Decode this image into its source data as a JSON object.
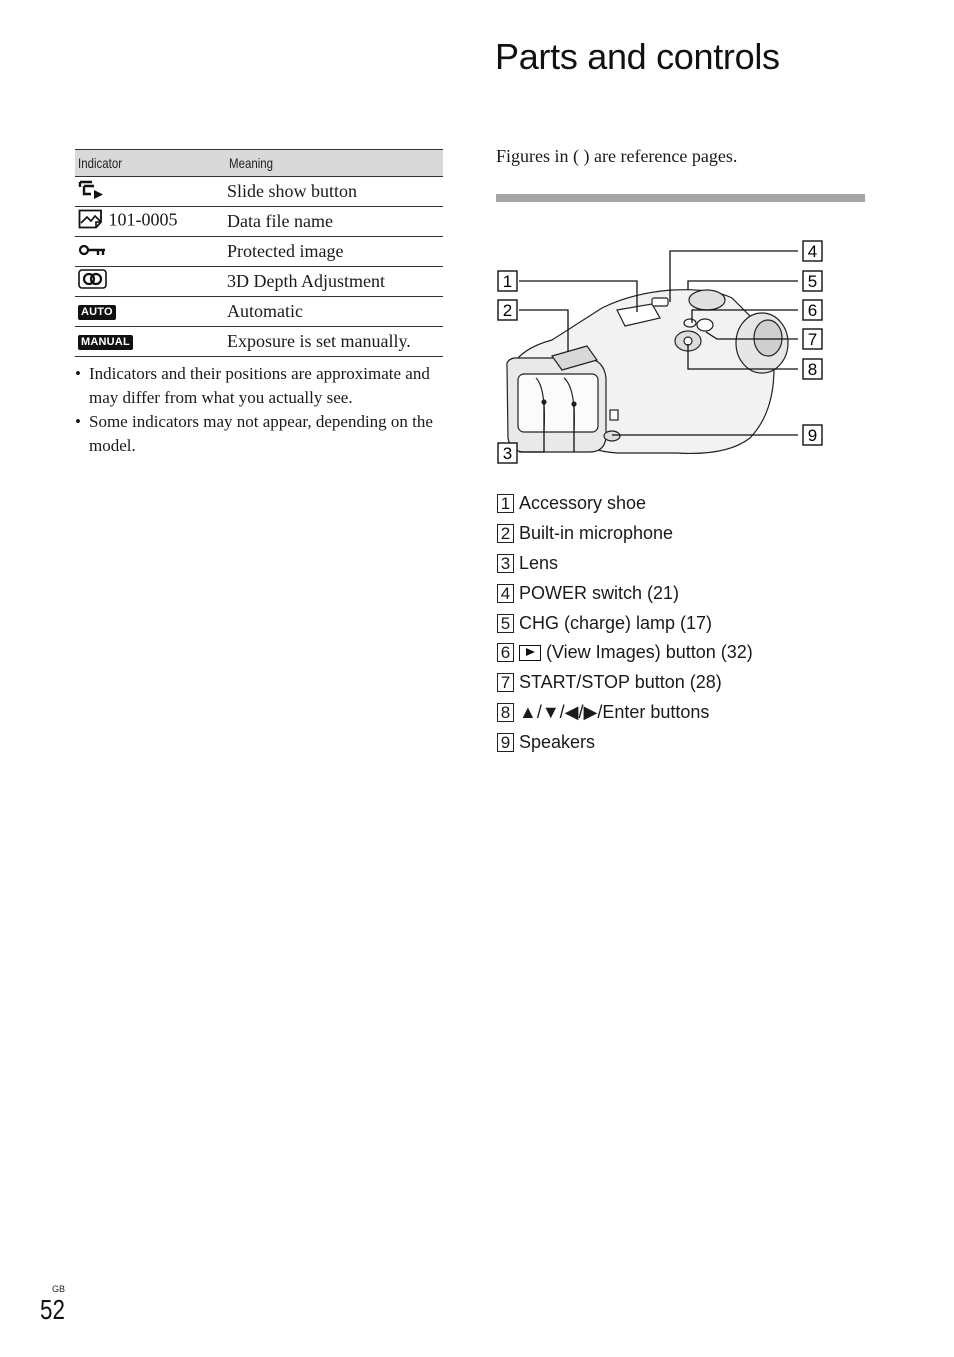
{
  "header": {
    "title": "Parts and controls"
  },
  "indicator_table": {
    "columns": [
      "Indicator",
      "Meaning"
    ],
    "rows": [
      {
        "icon": "slide-show-icon",
        "indicator_text": "",
        "meaning": "Slide show button"
      },
      {
        "icon": "data-file-icon",
        "indicator_text": "101-0005",
        "meaning": "Data file name"
      },
      {
        "icon": "protect-key-icon",
        "indicator_text": "",
        "meaning": "Protected image"
      },
      {
        "icon": "3d-depth-icon",
        "indicator_text": "",
        "meaning": "3D Depth Adjustment"
      },
      {
        "icon": "auto-badge",
        "indicator_text": "AUTO",
        "meaning": "Automatic"
      },
      {
        "icon": "manual-badge",
        "indicator_text": "MANUAL",
        "meaning": "Exposure is set manually."
      }
    ]
  },
  "notes": {
    "bullet": "•",
    "items": [
      "Indicators and their positions are approximate and may differ from what you actually see.",
      "Some indicators may not appear, depending on the model."
    ]
  },
  "intro": {
    "text": "Figures in ( ) are reference pages."
  },
  "figure": {
    "description": "Binocular camera (DEV-series) overview with numbered callouts",
    "callouts": [
      "1",
      "2",
      "3",
      "4",
      "5",
      "6",
      "7",
      "8",
      "9"
    ]
  },
  "parts": [
    {
      "num": "1",
      "label": "Accessory shoe"
    },
    {
      "num": "2",
      "label": "Built-in microphone"
    },
    {
      "num": "3",
      "label": "Lens"
    },
    {
      "num": "4",
      "label": "POWER switch (21)"
    },
    {
      "num": "5",
      "label": "CHG (charge) lamp (17)"
    },
    {
      "num": "6",
      "label": "(View Images) button (32)",
      "icon": "view-images-icon"
    },
    {
      "num": "7",
      "label": "START/STOP button (28)"
    },
    {
      "num": "8",
      "label": "▲/▼/◀/▶/Enter buttons"
    },
    {
      "num": "9",
      "label": "Speakers"
    }
  ],
  "footer": {
    "region": "GB",
    "page_number": "52"
  }
}
